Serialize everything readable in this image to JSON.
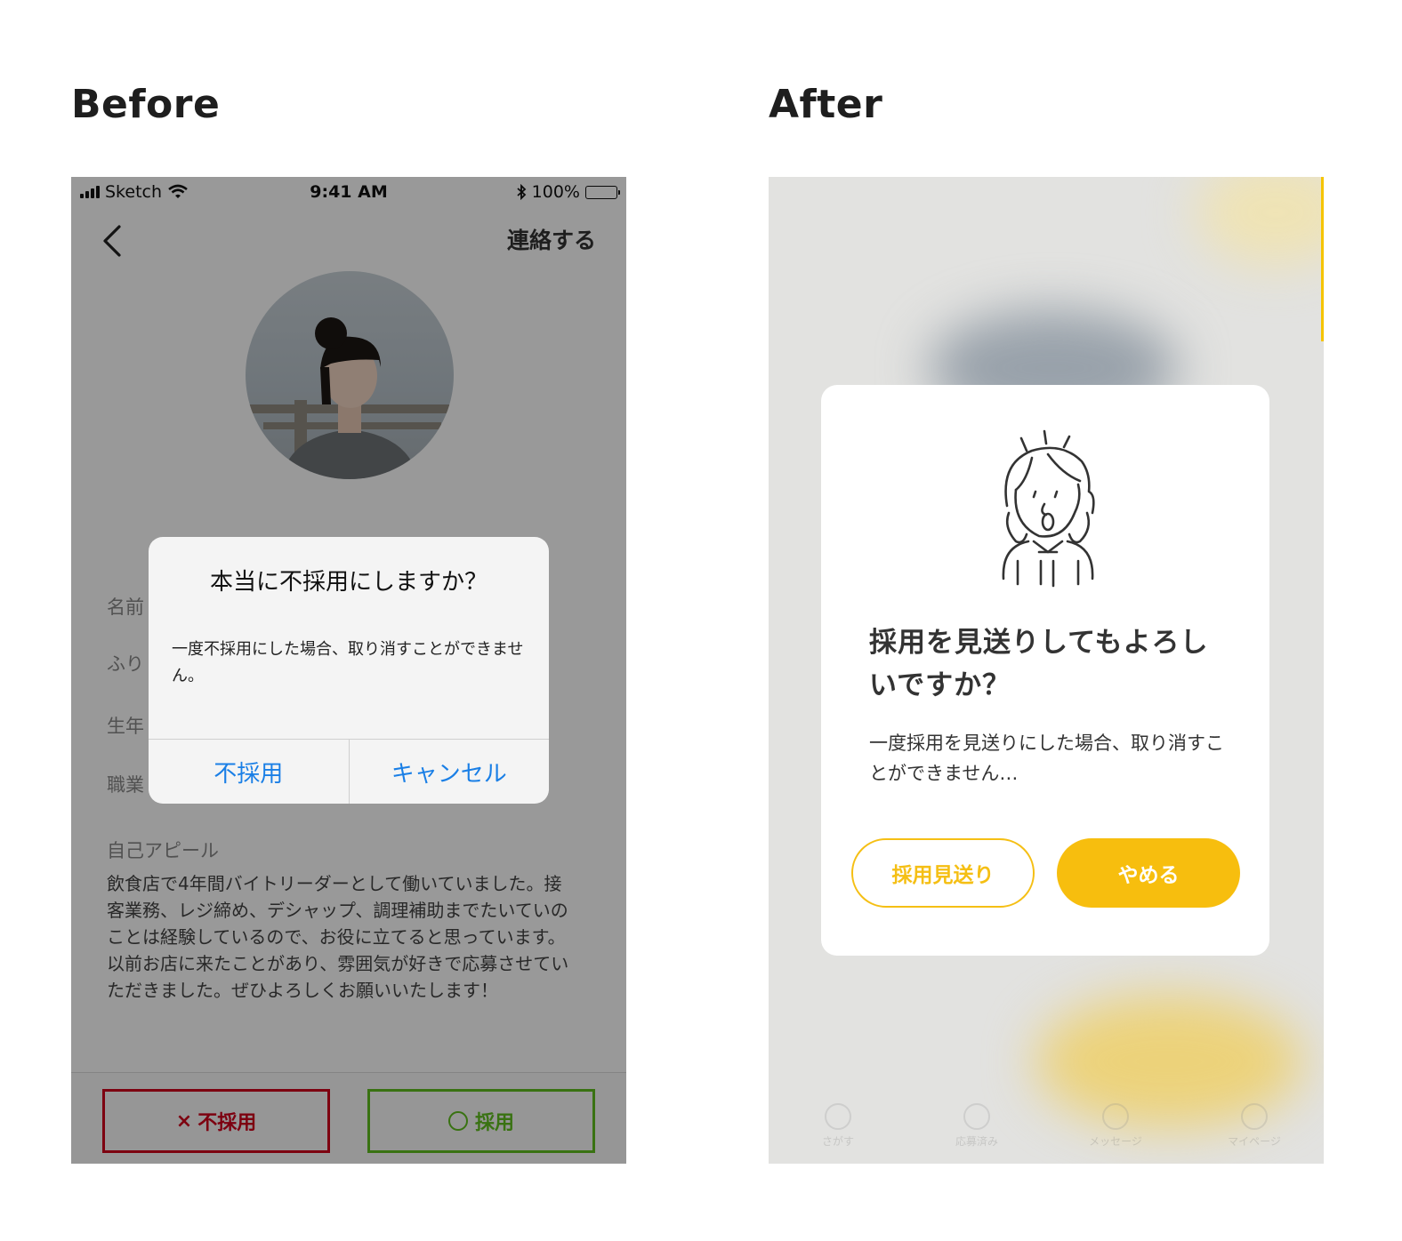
{
  "headings": {
    "before": "Before",
    "after": "After"
  },
  "before": {
    "status_bar": {
      "carrier": "Sketch",
      "time": "9:41 AM",
      "battery": "100%"
    },
    "nav": {
      "contact": "連絡する"
    },
    "fields": {
      "name": "名前",
      "furigana": "ふり",
      "birth": "生年",
      "job": "職業"
    },
    "appeal": {
      "title": "自己アピール",
      "body": "飲食店で4年間バイトリーダーとして働いていました。接客業務、レジ締め、デシャップ、調理補助までたいていのことは経験しているので、お役に立てると思っています。以前お店に来たことがあり、雰囲気が好きで応募させていただきました。ぜひよろしくお願いいたします！"
    },
    "buttons": {
      "reject_mark": "×",
      "reject": "不採用",
      "accept": "採用"
    },
    "alert": {
      "title": "本当に不採用にしますか？",
      "message": "一度不採用にした場合、取り消すことができません。",
      "reject": "不採用",
      "cancel": "キャンセル"
    }
  },
  "after": {
    "modal": {
      "title": "採用を見送りしてもよろしいですか？",
      "message": "一度採用を見送りにした場合、取り消すことができません…",
      "decline": "採用見送り",
      "stop": "やめる"
    },
    "tabs": [
      "さがす",
      "応募済み",
      "メッセージ",
      "マイページ"
    ]
  },
  "colors": {
    "reject": "#d0021b",
    "accept": "#5fbf1f",
    "ios_blue": "#1a7fe6",
    "brand_yellow": "#f7be0e"
  }
}
